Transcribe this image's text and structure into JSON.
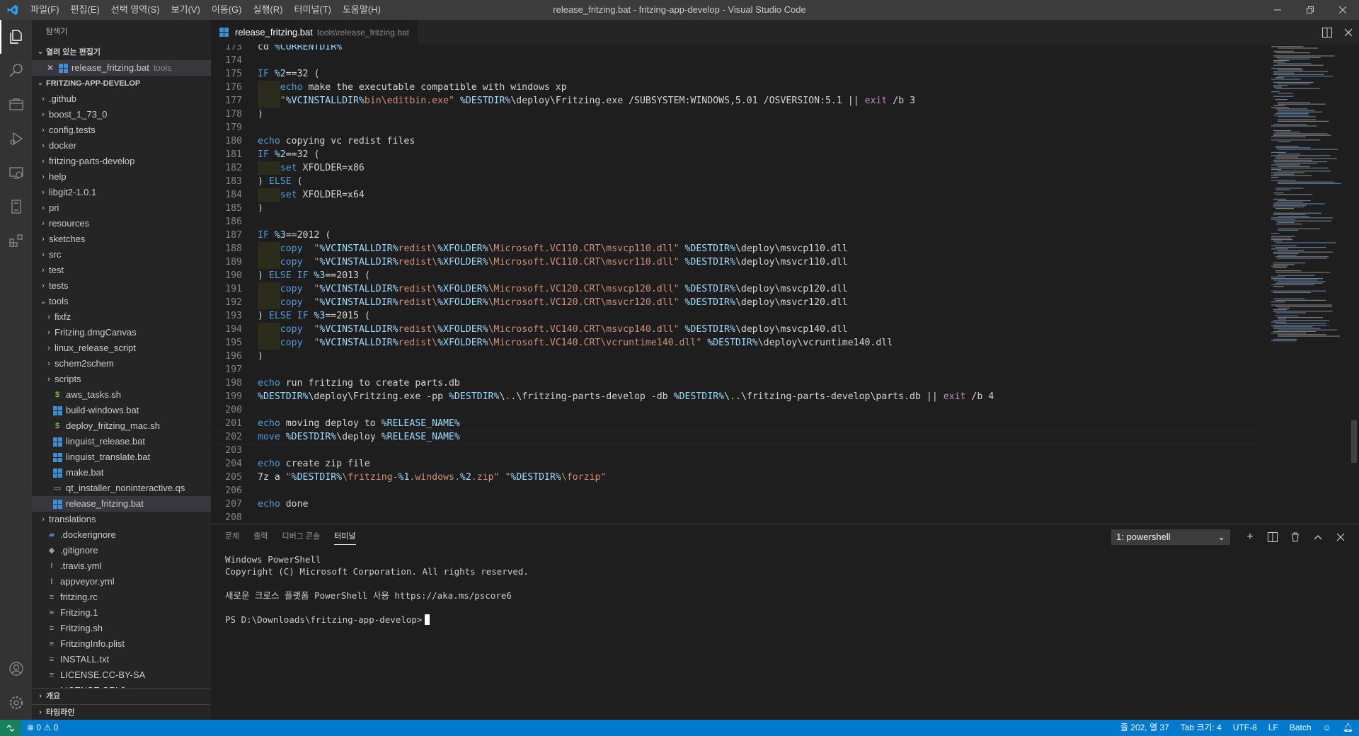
{
  "window": {
    "title": "release_fritzing.bat - fritzing-app-develop - Visual Studio Code",
    "menu": [
      "파일(F)",
      "편집(E)",
      "선택 영역(S)",
      "보기(V)",
      "이동(G)",
      "실행(R)",
      "터미널(T)",
      "도움말(H)"
    ]
  },
  "sidebar": {
    "title": "탐색기",
    "open_editors_label": "열려 있는 편집기",
    "open_editor": {
      "name": "release_fritzing.bat",
      "folder": "tools"
    },
    "project_label": "FRITZING-APP-DEVELOP",
    "tree": [
      {
        "label": ".github",
        "type": "folder",
        "depth": 0
      },
      {
        "label": "boost_1_73_0",
        "type": "folder",
        "depth": 0
      },
      {
        "label": "config.tests",
        "type": "folder",
        "depth": 0
      },
      {
        "label": "docker",
        "type": "folder",
        "depth": 0
      },
      {
        "label": "fritzing-parts-develop",
        "type": "folder",
        "depth": 0
      },
      {
        "label": "help",
        "type": "folder",
        "depth": 0
      },
      {
        "label": "libgit2-1.0.1",
        "type": "folder",
        "depth": 0
      },
      {
        "label": "pri",
        "type": "folder",
        "depth": 0
      },
      {
        "label": "resources",
        "type": "folder",
        "depth": 0
      },
      {
        "label": "sketches",
        "type": "folder",
        "depth": 0
      },
      {
        "label": "src",
        "type": "folder",
        "depth": 0
      },
      {
        "label": "test",
        "type": "folder",
        "depth": 0
      },
      {
        "label": "tests",
        "type": "folder",
        "depth": 0
      },
      {
        "label": "tools",
        "type": "folder-open",
        "depth": 0
      },
      {
        "label": "fixfz",
        "type": "folder",
        "depth": 1
      },
      {
        "label": "Fritzing.dmgCanvas",
        "type": "folder",
        "depth": 1
      },
      {
        "label": "linux_release_script",
        "type": "folder",
        "depth": 1
      },
      {
        "label": "schem2schem",
        "type": "folder",
        "depth": 1
      },
      {
        "label": "scripts",
        "type": "folder",
        "depth": 1
      },
      {
        "label": "aws_tasks.sh",
        "type": "sh",
        "depth": 1
      },
      {
        "label": "build-windows.bat",
        "type": "bat",
        "depth": 1
      },
      {
        "label": "deploy_fritzing_mac.sh",
        "type": "sh",
        "depth": 1
      },
      {
        "label": "linguist_release.bat",
        "type": "bat",
        "depth": 1
      },
      {
        "label": "linguist_translate.bat",
        "type": "bat",
        "depth": 1
      },
      {
        "label": "make.bat",
        "type": "bat",
        "depth": 1
      },
      {
        "label": "qt_installer_noninteractive.qs",
        "type": "file",
        "depth": 1
      },
      {
        "label": "release_fritzing.bat",
        "type": "bat",
        "depth": 1,
        "selected": true
      },
      {
        "label": "translations",
        "type": "folder",
        "depth": 0
      },
      {
        "label": ".dockerignore",
        "type": "docker",
        "depth": 0
      },
      {
        "label": ".gitignore",
        "type": "git",
        "depth": 0
      },
      {
        "label": ".travis.yml",
        "type": "yml",
        "depth": 0
      },
      {
        "label": "appveyor.yml",
        "type": "yml",
        "depth": 0
      },
      {
        "label": "fritzing.rc",
        "type": "text",
        "depth": 0
      },
      {
        "label": "Fritzing.1",
        "type": "text",
        "depth": 0
      },
      {
        "label": "Fritzing.sh",
        "type": "text",
        "depth": 0
      },
      {
        "label": "FritzingInfo.plist",
        "type": "text",
        "depth": 0
      },
      {
        "label": "INSTALL.txt",
        "type": "text",
        "depth": 0
      },
      {
        "label": "LICENSE.CC-BY-SA",
        "type": "text",
        "depth": 0
      },
      {
        "label": "LICENSE.GPL2",
        "type": "text",
        "depth": 0
      }
    ],
    "outline_label": "개요",
    "timeline_label": "타임라인"
  },
  "editor": {
    "tab": {
      "name": "release_fritzing.bat",
      "path": "tools\\release_fritzing.bat"
    },
    "current_line": 202,
    "lines": [
      {
        "n": 173,
        "t": "cd %CURRENTDIR%"
      },
      {
        "n": 174,
        "t": ""
      },
      {
        "n": 175,
        "t": "IF %2==32 ("
      },
      {
        "n": 176,
        "t": "    echo make the executable compatible with windows xp"
      },
      {
        "n": 177,
        "t": "    \"%VCINSTALLDIR%bin\\editbin.exe\" %DESTDIR%\\deploy\\Fritzing.exe /SUBSYSTEM:WINDOWS,5.01 /OSVERSION:5.1 || exit /b 3"
      },
      {
        "n": 178,
        "t": ")"
      },
      {
        "n": 179,
        "t": ""
      },
      {
        "n": 180,
        "t": "echo copying vc redist files"
      },
      {
        "n": 181,
        "t": "IF %2==32 ("
      },
      {
        "n": 182,
        "t": "    set XFOLDER=x86"
      },
      {
        "n": 183,
        "t": ") ELSE ("
      },
      {
        "n": 184,
        "t": "    set XFOLDER=x64"
      },
      {
        "n": 185,
        "t": ")"
      },
      {
        "n": 186,
        "t": ""
      },
      {
        "n": 187,
        "t": "IF %3==2012 ("
      },
      {
        "n": 188,
        "t": "    copy  \"%VCINSTALLDIR%redist\\%XFOLDER%\\Microsoft.VC110.CRT\\msvcp110.dll\" %DESTDIR%\\deploy\\msvcp110.dll"
      },
      {
        "n": 189,
        "t": "    copy  \"%VCINSTALLDIR%redist\\%XFOLDER%\\Microsoft.VC110.CRT\\msvcr110.dll\" %DESTDIR%\\deploy\\msvcr110.dll"
      },
      {
        "n": 190,
        "t": ") ELSE IF %3==2013 ("
      },
      {
        "n": 191,
        "t": "    copy  \"%VCINSTALLDIR%redist\\%XFOLDER%\\Microsoft.VC120.CRT\\msvcp120.dll\" %DESTDIR%\\deploy\\msvcp120.dll"
      },
      {
        "n": 192,
        "t": "    copy  \"%VCINSTALLDIR%redist\\%XFOLDER%\\Microsoft.VC120.CRT\\msvcr120.dll\" %DESTDIR%\\deploy\\msvcr120.dll"
      },
      {
        "n": 193,
        "t": ") ELSE IF %3==2015 ("
      },
      {
        "n": 194,
        "t": "    copy  \"%VCINSTALLDIR%redist\\%XFOLDER%\\Microsoft.VC140.CRT\\msvcp140.dll\" %DESTDIR%\\deploy\\msvcp140.dll"
      },
      {
        "n": 195,
        "t": "    copy  \"%VCINSTALLDIR%redist\\%XFOLDER%\\Microsoft.VC140.CRT\\vcruntime140.dll\" %DESTDIR%\\deploy\\vcruntime140.dll"
      },
      {
        "n": 196,
        "t": ")"
      },
      {
        "n": 197,
        "t": ""
      },
      {
        "n": 198,
        "t": "echo run fritzing to create parts.db"
      },
      {
        "n": 199,
        "t": "%DESTDIR%\\deploy\\Fritzing.exe -pp %DESTDIR%\\..\\fritzing-parts-develop -db %DESTDIR%\\..\\fritzing-parts-develop\\parts.db || exit /b 4"
      },
      {
        "n": 200,
        "t": ""
      },
      {
        "n": 201,
        "t": "echo moving deploy to %RELEASE_NAME%"
      },
      {
        "n": 202,
        "t": "move %DESTDIR%\\deploy %RELEASE_NAME%"
      },
      {
        "n": 203,
        "t": ""
      },
      {
        "n": 204,
        "t": "echo create zip file"
      },
      {
        "n": 205,
        "t": "7z a \"%DESTDIR%\\fritzing-%1.windows.%2.zip\" \"%DESTDIR%\\forzip\""
      },
      {
        "n": 206,
        "t": ""
      },
      {
        "n": 207,
        "t": "echo done"
      },
      {
        "n": 208,
        "t": ""
      }
    ],
    "scroll_position_fraction": 0.86
  },
  "panel": {
    "tabs": [
      "문제",
      "출력",
      "디버그 콘솔",
      "터미널"
    ],
    "active_tab": "터미널",
    "terminal_select": "1: powershell",
    "terminal_lines": [
      "Windows PowerShell",
      "Copyright (C) Microsoft Corporation. All rights reserved.",
      "",
      "새로운 크로스 플랫폼 PowerShell 사용 https://aka.ms/pscore6",
      "",
      "PS D:\\Downloads\\fritzing-app-develop>"
    ]
  },
  "statusbar": {
    "problems": "0",
    "warnings": "0",
    "position": "줄 202, 열 37",
    "tab_size": "Tab 크기: 4",
    "encoding": "UTF-8",
    "eol": "LF",
    "language": "Batch"
  },
  "colors": {
    "statusbar": "#007acc",
    "remote": "#16825d",
    "keyword": "#569cd6",
    "variable": "#9cdcfe",
    "string": "#ce9178",
    "bracket_red": "#f44747"
  }
}
